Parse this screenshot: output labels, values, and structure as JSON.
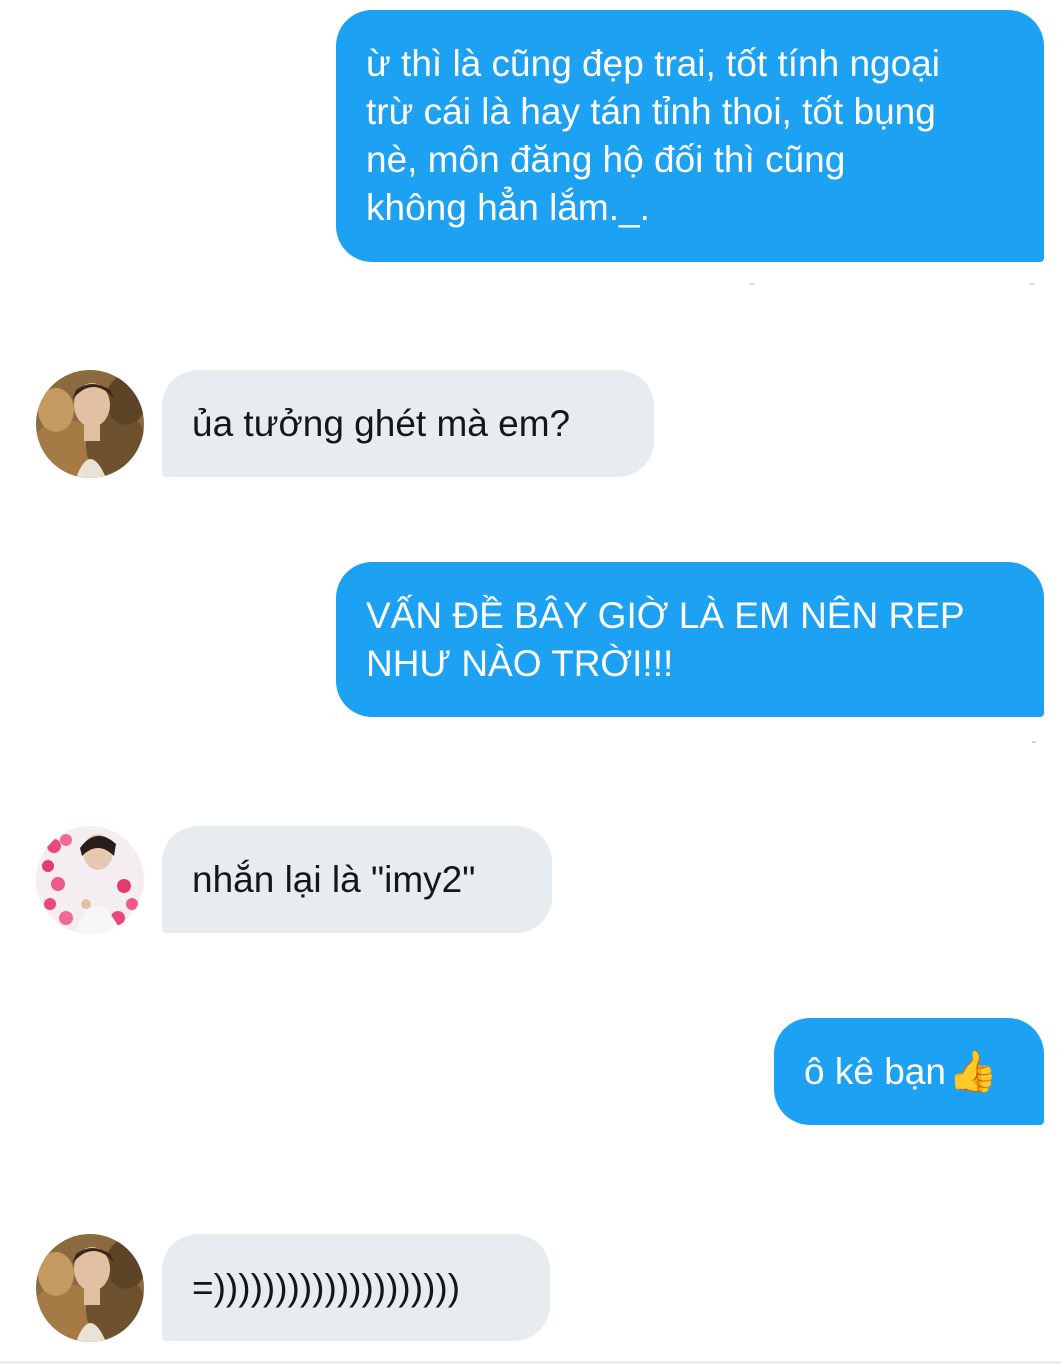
{
  "conversation": {
    "messages": [
      {
        "id": 1,
        "direction": "sent",
        "text": "ừ thì là cũng đẹp trai, tốt tính ngoại\ntrừ cái là hay tán tỉnh thoi, tốt bụng\nnè, môn đăng hộ đối thì cũng\nkhông hẳn lắm._."
      },
      {
        "id": 2,
        "direction": "received",
        "text": "ủa tưởng ghét mà em?",
        "avatar": "avatar-fur-coat"
      },
      {
        "id": 3,
        "direction": "sent",
        "text": "VẤN ĐỀ BÂY GIỜ LÀ EM NÊN REP\nNHƯ NÀO TRỜI!!!"
      },
      {
        "id": 4,
        "direction": "received",
        "text": "nhắn lại là \"imy2\"",
        "avatar": "avatar-hearts"
      },
      {
        "id": 5,
        "direction": "sent",
        "text": "ô kê bạn",
        "emoji": "👍",
        "emoji_name": "thumbs-up-icon"
      },
      {
        "id": 6,
        "direction": "received",
        "text": "=))))))))))))))))))))",
        "avatar": "avatar-fur-coat"
      }
    ]
  },
  "colors": {
    "sent_bubble": "#1da1f2",
    "received_bubble": "#e6ecf0",
    "sent_text": "#ffffff",
    "received_text": "#14171a"
  }
}
